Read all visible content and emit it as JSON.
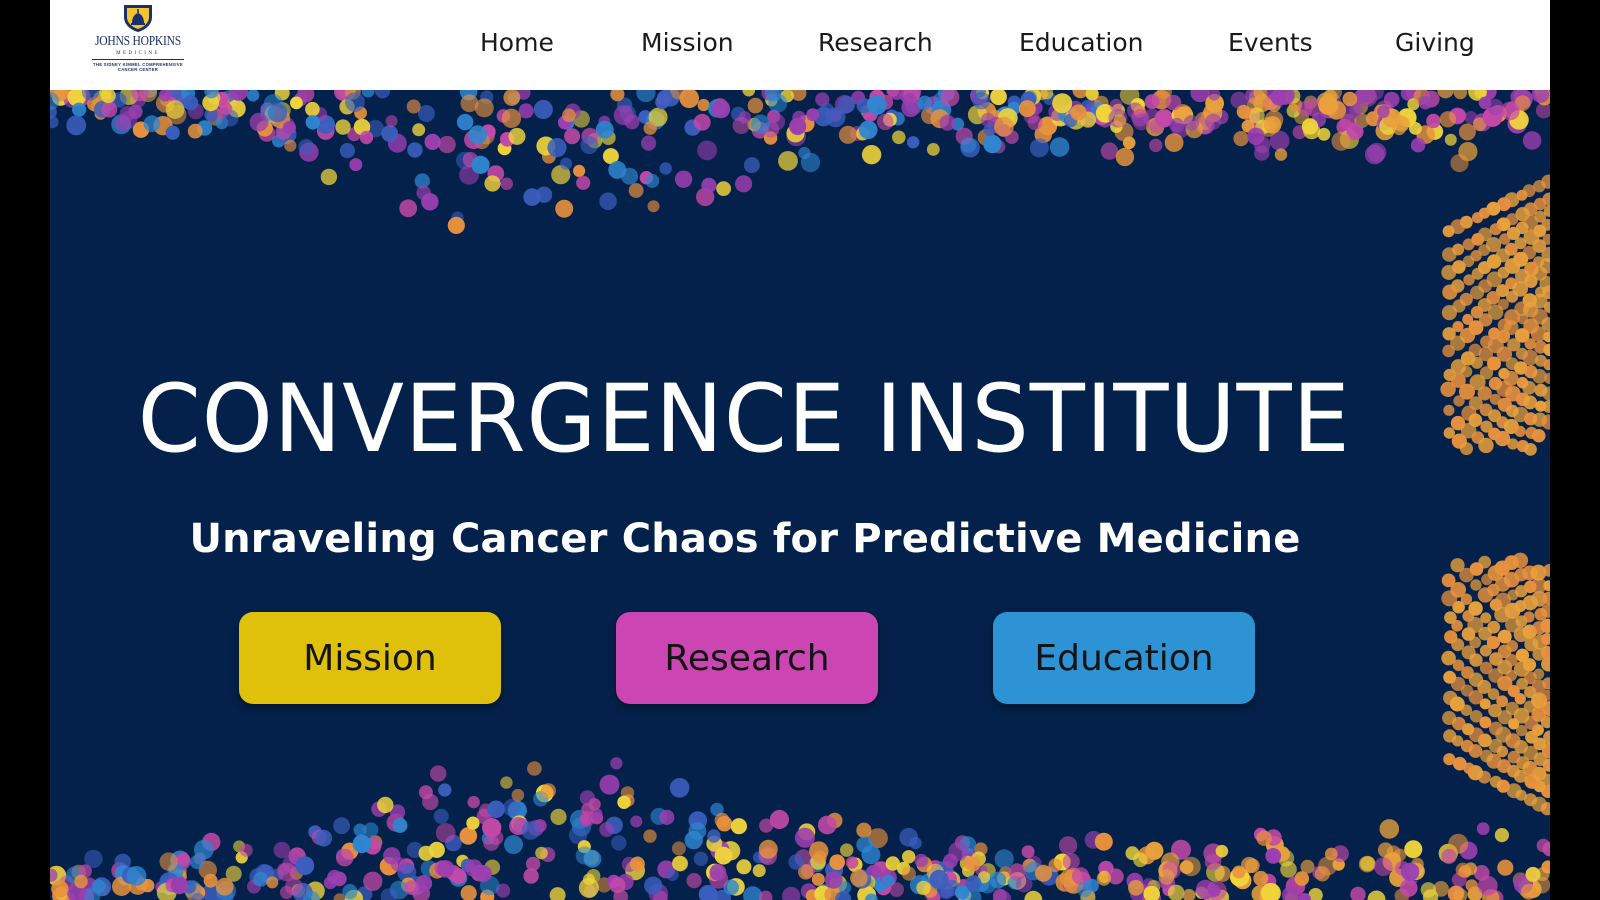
{
  "brand": {
    "name": "JOHNS HOPKINS",
    "subline": "MEDICINE",
    "fineprint": "THE SIDNEY KIMMEL COMPREHENSIVE CANCER CENTER"
  },
  "nav": {
    "items": [
      {
        "label": "Home"
      },
      {
        "label": "Mission"
      },
      {
        "label": "Research"
      },
      {
        "label": "Education"
      },
      {
        "label": "Events"
      },
      {
        "label": "Giving"
      }
    ]
  },
  "hero": {
    "title": "CONVERGENCE INSTITUTE",
    "subtitle": "Unraveling Cancer Chaos for Predictive Medicine",
    "buttons": [
      {
        "label": "Mission",
        "color": "#dfc10b"
      },
      {
        "label": "Research",
        "color": "#cc46b3"
      },
      {
        "label": "Education",
        "color": "#2d93d4"
      }
    ]
  },
  "colors": {
    "background": "#03214a",
    "dot_palette": [
      "#f0d43a",
      "#2f86d0",
      "#9b3fb0",
      "#c349a8",
      "#e8923e",
      "#3b5fbf",
      "#e9a13c"
    ]
  }
}
